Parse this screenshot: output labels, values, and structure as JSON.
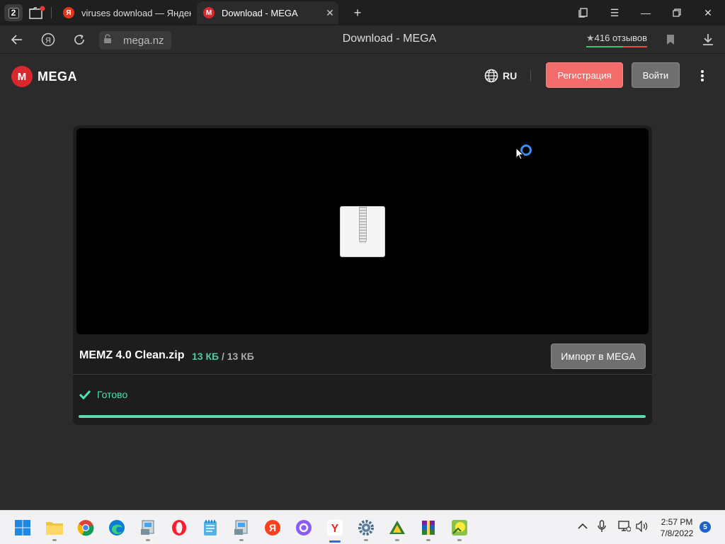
{
  "browser": {
    "tab_counter": "2",
    "tabs": [
      {
        "title": "viruses download — Яндекс",
        "favicon_letter": "Я",
        "favicon_color": "#e2361a"
      },
      {
        "title": "Download - MEGA",
        "favicon_letter": "M",
        "favicon_color": "#d9272e"
      }
    ],
    "url": "mega.nz",
    "page_title": "Download - MEGA",
    "reviews": "416 отзывов"
  },
  "mega": {
    "logo_letter": "M",
    "logo_text": "MEGA",
    "language": "RU",
    "register_label": "Регистрация",
    "login_label": "Войти",
    "accent": "#d9272e"
  },
  "download": {
    "file_name": "MEMZ 4.0 Clean.zip",
    "downloaded": "13 КБ",
    "separator": "/",
    "total": "13 КБ",
    "import_label": "Импорт в MEGA",
    "status_text": "Готово",
    "progress_percent": 100,
    "status_color": "#4fe0b4"
  },
  "taskbar": {
    "time": "2:57 PM",
    "date": "7/8/2022",
    "notifications": "5",
    "apps": [
      "start-icon",
      "file-explorer-icon",
      "chrome-icon",
      "edge-icon",
      "setup-icon",
      "opera-icon",
      "notepad-icon",
      "setup2-icon",
      "yandex-icon",
      "alice-icon",
      "yandex-browser-icon",
      "settings-icon",
      "xmeters-icon",
      "winrar-icon",
      "game-icon"
    ]
  }
}
